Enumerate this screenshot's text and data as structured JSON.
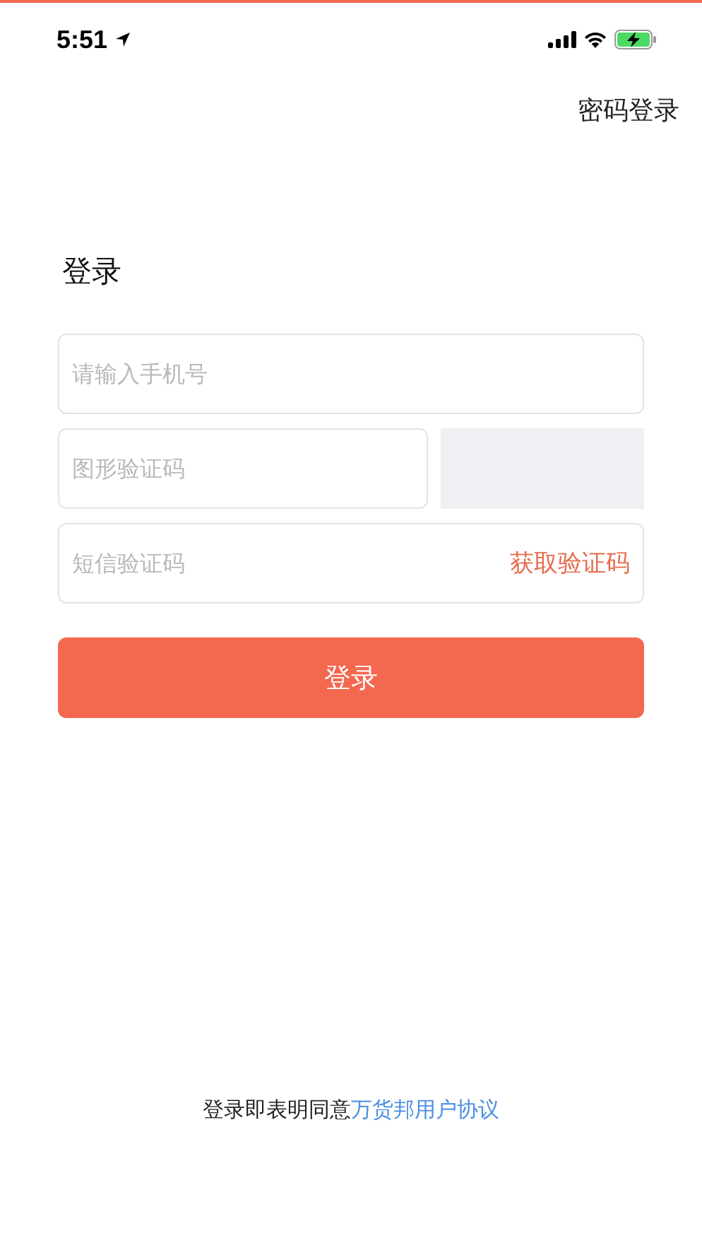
{
  "status_bar": {
    "time": "5:51"
  },
  "header": {
    "switch_link": "密码登录"
  },
  "title": "登录",
  "phone_field": {
    "placeholder": "请输入手机号"
  },
  "captcha_field": {
    "placeholder": "图形验证码"
  },
  "sms_field": {
    "placeholder": "短信验证码",
    "action": "获取验证码"
  },
  "login_button": "登录",
  "agreement": {
    "text": "登录即表明同意",
    "link": "万货邦用户协议"
  }
}
